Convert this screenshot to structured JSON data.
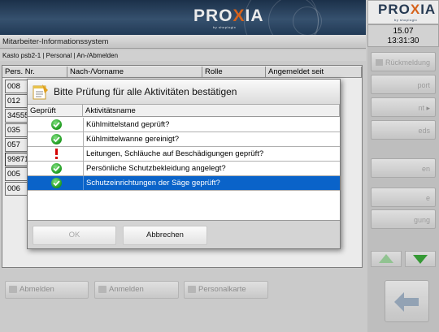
{
  "header": {
    "logo_text_a": "PRO",
    "logo_text_x": "X",
    "logo_text_b": "IA",
    "logo_sub": "by shoplogix"
  },
  "clock": {
    "date": "15.07",
    "time": "13:31:30"
  },
  "app": {
    "title": "Mitarbeiter-Informationssystem",
    "breadcrumb": "Kasto psb2-1 | Personal | An-/Abmelden"
  },
  "table": {
    "columns": [
      "Pers. Nr.",
      "Nach-/Vorname",
      "Rolle",
      "Angemeldet seit"
    ],
    "rows": [
      "008",
      "012",
      "34555",
      "035",
      "057",
      "99871",
      "005",
      "006"
    ]
  },
  "side_buttons": [
    "Rückmeldung",
    "port",
    "nt",
    "eds",
    "en",
    "e",
    "gung"
  ],
  "bottom_buttons": [
    "Abmelden",
    "Anmelden",
    "Personalkarte"
  ],
  "modal": {
    "title": "Bitte Prüfung für alle Aktivitäten bestätigen",
    "col_checked": "Geprüft",
    "col_activity": "Aktivitätsname",
    "items": [
      {
        "status": "ok",
        "name": "Kühlmittelstand geprüft?"
      },
      {
        "status": "ok",
        "name": "Kühlmittelwanne gereinigt?"
      },
      {
        "status": "warning",
        "name": "Leitungen, Schläuche auf Beschädigungen geprüft?"
      },
      {
        "status": "ok",
        "name": "Persönliche Schutzbekleidung angelegt?"
      },
      {
        "status": "ok",
        "name": "Schutzeinrichtungen der Säge geprüft?"
      }
    ],
    "ok_label": "OK",
    "cancel_label": "Abbrechen"
  },
  "colors": {
    "accent": "#0a63c9",
    "ok": "#1e9a1e",
    "warning": "#d40000",
    "logo_x": "#e86b1e"
  },
  "icons": [
    "checklist-icon",
    "check-circle-icon",
    "exclamation-icon",
    "arrow-up-icon",
    "arrow-down-icon",
    "back-arrow-icon"
  ]
}
